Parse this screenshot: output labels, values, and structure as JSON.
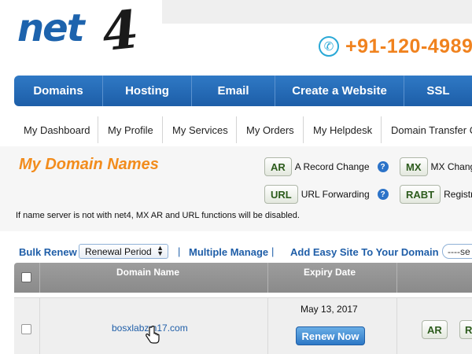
{
  "header": {
    "logo": {
      "text": "net",
      "digit": "4"
    },
    "phone": {
      "icon": "phone-icon",
      "number": "+91-120-4989"
    }
  },
  "main_nav": [
    {
      "label": "Domains"
    },
    {
      "label": "Hosting"
    },
    {
      "label": "Email"
    },
    {
      "label": "Create a Website"
    },
    {
      "label": "SSL"
    }
  ],
  "sub_nav": [
    {
      "label": "My Dashboard"
    },
    {
      "label": "My Profile"
    },
    {
      "label": "My Services"
    },
    {
      "label": "My Orders"
    },
    {
      "label": "My Helpdesk"
    },
    {
      "label": "Domain Transfer C"
    }
  ],
  "domains_section": {
    "title": "My Domain Names",
    "legend": [
      {
        "badge": "AR",
        "label": "A Record Change",
        "help": "?"
      },
      {
        "badge": "MX",
        "label": "MX Chang"
      },
      {
        "badge": "URL",
        "label": "URL Forwarding",
        "help": "?"
      },
      {
        "badge": "RABT",
        "label": "Registr"
      }
    ],
    "notice": "If name server is not with net4, MX AR and URL functions will be disabled."
  },
  "toolbar": {
    "bulk_renew": "Bulk Renew",
    "renewal_period": {
      "selected": "Renewal Period"
    },
    "separator": "|",
    "multiple_manage": "Multiple Manage",
    "add_easy_site": "Add Easy Site To Your Domain",
    "search_select": "----se"
  },
  "table": {
    "columns": [
      "Domain Name",
      "Expiry Date"
    ],
    "rows": [
      {
        "domain": "bosxlabzm17.com",
        "expiry": "May 13, 2017",
        "renew_label": "Renew Now",
        "actions": [
          "AR",
          "R"
        ]
      }
    ]
  },
  "colors": {
    "nav_blue": "#1d5ea8",
    "title_orange": "#f28c1c",
    "phone_orange": "#f0821e",
    "link_blue": "#1f5ea8",
    "badge_green": "#2c5b1c"
  }
}
